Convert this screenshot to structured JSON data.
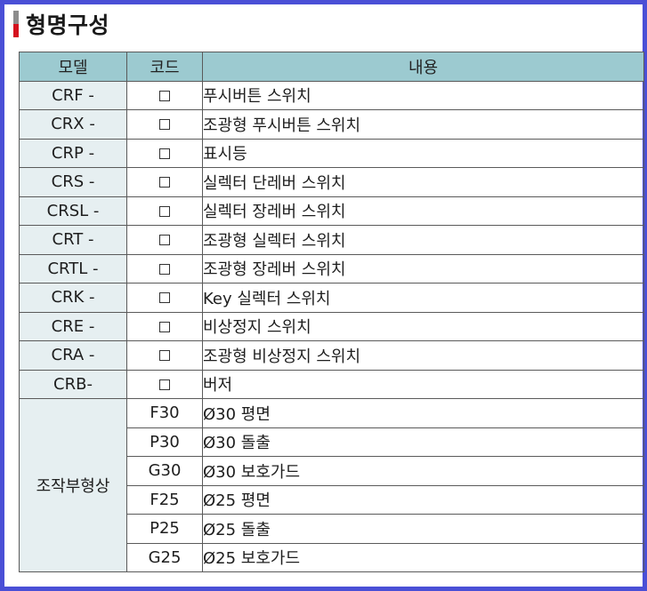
{
  "title": "형명구성",
  "headers": {
    "model": "모델",
    "code": "코드",
    "desc": "내용"
  },
  "models": [
    {
      "model": "CRF -",
      "code": "□",
      "desc": "푸시버튼 스위치"
    },
    {
      "model": "CRX -",
      "code": "□",
      "desc": "조광형 푸시버튼 스위치"
    },
    {
      "model": "CRP -",
      "code": "□",
      "desc": "표시등"
    },
    {
      "model": "CRS -",
      "code": "□",
      "desc": "실렉터 단레버 스위치"
    },
    {
      "model": "CRSL -",
      "code": "□",
      "desc": "실렉터 장레버 스위치"
    },
    {
      "model": "CRT -",
      "code": "□",
      "desc": "조광형 실렉터 스위치"
    },
    {
      "model": "CRTL -",
      "code": "□",
      "desc": "조광형 장레버 스위치"
    },
    {
      "model": "CRK -",
      "code": "□",
      "desc": "Key 실렉터 스위치"
    },
    {
      "model": "CRE -",
      "code": "□",
      "desc": "비상정지 스위치"
    },
    {
      "model": "CRA -",
      "code": "□",
      "desc": "조광형 비상정지 스위치"
    },
    {
      "model": "CRB-",
      "code": "□",
      "desc": "버저"
    }
  ],
  "operator_group": {
    "label": "조작부형상",
    "rows": [
      {
        "code": "F30",
        "desc": "Ø30 평면"
      },
      {
        "code": "P30",
        "desc": "Ø30 돌출"
      },
      {
        "code": "G30",
        "desc": "Ø30 보호가드"
      },
      {
        "code": "F25",
        "desc": "Ø25 평면"
      },
      {
        "code": "P25",
        "desc": "Ø25 돌출"
      },
      {
        "code": "G25",
        "desc": "Ø25 보호가드"
      }
    ]
  }
}
